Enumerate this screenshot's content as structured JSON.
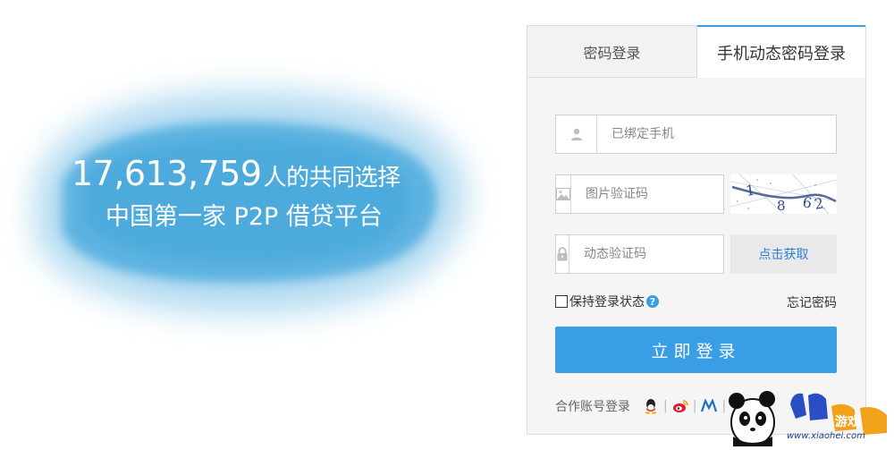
{
  "hero": {
    "count": "17,613,759",
    "count_suffix": "人的共同选择",
    "subtitle": "中国第一家 P2P 借贷平台"
  },
  "tabs": {
    "password_login": "密码登录",
    "phone_login": "手机动态密码登录",
    "active": "phone_login"
  },
  "form": {
    "phone_placeholder": "已绑定手机",
    "captcha_placeholder": "图片验证码",
    "sms_placeholder": "动态验证码",
    "captcha_chars": "1 8 6 2",
    "get_code_label": "点击获取",
    "remember_label": "保持登录状态",
    "help_label": "?",
    "forgot_label": "忘记密码",
    "submit_label": "立即登录"
  },
  "partner": {
    "label": "合作账号登录",
    "icons": [
      "qq-icon",
      "weibo-icon",
      "alipay-icon"
    ]
  },
  "watermark": {
    "site": "www.xiaohei.com"
  },
  "colors": {
    "accent": "#3a9ee6",
    "link": "#2a7fd4",
    "splash": "#5bb2e0"
  }
}
